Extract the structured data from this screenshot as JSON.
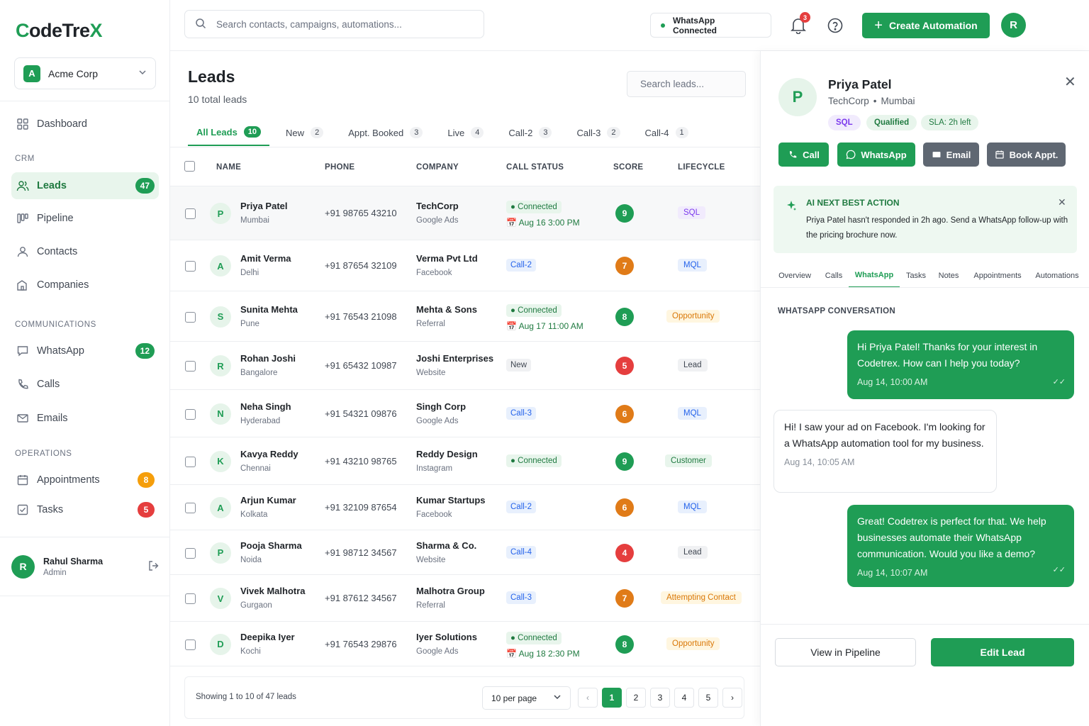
{
  "brand": {
    "logo_text": "CodeTreX",
    "accent": "#1f9d55"
  },
  "sidebar": {
    "org": {
      "initial": "A",
      "name": "Acme Corp"
    },
    "dashboard": "Dashboard",
    "sections": {
      "crm": "CRM",
      "communications": "COMMUNICATIONS",
      "operations": "OPERATIONS"
    },
    "items": [
      {
        "label": "Leads",
        "count": "47"
      },
      {
        "label": "Pipeline"
      },
      {
        "label": "Contacts"
      },
      {
        "label": "Companies"
      },
      {
        "label": "WhatsApp",
        "count": "12"
      },
      {
        "label": "Calls"
      },
      {
        "label": "Emails"
      },
      {
        "label": "Appointments",
        "count": "8"
      },
      {
        "label": "Tasks",
        "count": "5"
      }
    ],
    "user": {
      "initial": "R",
      "name": "Rahul Sharma",
      "role": "Admin"
    }
  },
  "topbar": {
    "search_placeholder": "Search contacts, campaigns, automations...",
    "wa_status": "WhatsApp Connected",
    "notifications": "3",
    "create_label": "Create Automation",
    "avatar": "R"
  },
  "leads": {
    "title": "Leads",
    "subtitle": "10 total leads",
    "search_placeholder": "Search leads...",
    "tabs": [
      {
        "label": "All Leads",
        "count": "10"
      },
      {
        "label": "New",
        "count": "2"
      },
      {
        "label": "Appt. Booked",
        "count": "3"
      },
      {
        "label": "Live",
        "count": "4"
      },
      {
        "label": "Call-2",
        "count": "3"
      },
      {
        "label": "Call-3",
        "count": "2"
      },
      {
        "label": "Call-4",
        "count": "1"
      }
    ],
    "columns": {
      "name": "NAME",
      "phone": "PHONE",
      "company": "COMPANY",
      "status": "CALL STATUS",
      "score": "SCORE",
      "lifecycle": "LIFECYCLE"
    },
    "rows": [
      {
        "initial": "P",
        "name": "Priya Patel",
        "city": "Mumbai",
        "phone": "+91 98765 43210",
        "company": "TechCorp",
        "source": "Google Ads",
        "status": "Connected",
        "appt": "Aug 16 3:00 PM",
        "score": "9",
        "lifecycle": "SQL"
      },
      {
        "initial": "A",
        "name": "Amit Verma",
        "city": "Delhi",
        "phone": "+91 87654 32109",
        "company": "Verma Pvt Ltd",
        "source": "Facebook",
        "status": "Call-2",
        "appt": "",
        "score": "7",
        "lifecycle": "MQL"
      },
      {
        "initial": "S",
        "name": "Sunita Mehta",
        "city": "Pune",
        "phone": "+91 76543 21098",
        "company": "Mehta & Sons",
        "source": "Referral",
        "status": "Connected",
        "appt": "Aug 17 11:00 AM",
        "score": "8",
        "lifecycle": "Opportunity"
      },
      {
        "initial": "R",
        "name": "Rohan Joshi",
        "city": "Bangalore",
        "phone": "+91 65432 10987",
        "company": "Joshi Enterprises",
        "source": "Website",
        "status": "New",
        "appt": "",
        "score": "5",
        "lifecycle": "Lead"
      },
      {
        "initial": "N",
        "name": "Neha Singh",
        "city": "Hyderabad",
        "phone": "+91 54321 09876",
        "company": "Singh Corp",
        "source": "Google Ads",
        "status": "Call-3",
        "appt": "",
        "score": "6",
        "lifecycle": "MQL"
      },
      {
        "initial": "K",
        "name": "Kavya Reddy",
        "city": "Chennai",
        "phone": "+91 43210 98765",
        "company": "Reddy Design",
        "source": "Instagram",
        "status": "Connected",
        "appt": "",
        "score": "9",
        "lifecycle": "Customer"
      },
      {
        "initial": "A",
        "name": "Arjun Kumar",
        "city": "Kolkata",
        "phone": "+91 32109 87654",
        "company": "Kumar Startups",
        "source": "Facebook",
        "status": "Call-2",
        "appt": "",
        "score": "6",
        "lifecycle": "MQL"
      },
      {
        "initial": "P",
        "name": "Pooja Sharma",
        "city": "Noida",
        "phone": "+91 98712 34567",
        "company": "Sharma & Co.",
        "source": "Website",
        "status": "Call-4",
        "appt": "",
        "score": "4",
        "lifecycle": "Lead"
      },
      {
        "initial": "V",
        "name": "Vivek Malhotra",
        "city": "Gurgaon",
        "phone": "+91 87612 34567",
        "company": "Malhotra Group",
        "source": "Referral",
        "status": "Call-3",
        "appt": "",
        "score": "7",
        "lifecycle": "Attempting Contact"
      },
      {
        "initial": "D",
        "name": "Deepika Iyer",
        "city": "Kochi",
        "phone": "+91 76543 29876",
        "company": "Iyer Solutions",
        "source": "Google Ads",
        "status": "Connected",
        "appt": "Aug 18 2:30 PM",
        "score": "8",
        "lifecycle": "Opportunity"
      }
    ],
    "pager": {
      "showing": "Showing 1 to 10 of 47 leads",
      "per_page": "10 per page",
      "pages": [
        "1",
        "2",
        "3",
        "4",
        "5"
      ],
      "prev": "‹",
      "next": "›"
    }
  },
  "panel": {
    "initial": "P",
    "name": "Priya Patel",
    "company": "TechCorp",
    "city": "Mumbai",
    "chips": {
      "stage": "SQL",
      "status": "Qualified",
      "sla": "SLA: 2h left"
    },
    "actions": {
      "call": "Call",
      "whatsapp": "WhatsApp",
      "email": "Email",
      "book": "Book Appt."
    },
    "ai": {
      "title": "AI NEXT BEST ACTION",
      "text": "Priya Patel hasn't responded in 2h ago. Send a WhatsApp follow-up with the pricing brochure now."
    },
    "tabs": [
      "Overview",
      "Calls",
      "WhatsApp",
      "Tasks",
      "Notes",
      "Appointments",
      "Automations"
    ],
    "conv_label": "WHATSAPP CONVERSATION",
    "messages": [
      {
        "dir": "out",
        "text": "Hi Priya Patel! Thanks for your interest in Codetrex. How can I help you today?",
        "time": "Aug 14, 10:00 AM"
      },
      {
        "dir": "in",
        "text": "Hi! I saw your ad on Facebook. I'm looking for a WhatsApp automation tool for my business.",
        "time": "Aug 14, 10:05 AM"
      },
      {
        "dir": "out",
        "text": "Great! Codetrex is perfect for that. We help businesses automate their WhatsApp communication. Would you like a demo?",
        "time": "Aug 14, 10:07 AM"
      }
    ],
    "footer": {
      "view": "View in Pipeline",
      "edit": "Edit Lead"
    }
  }
}
